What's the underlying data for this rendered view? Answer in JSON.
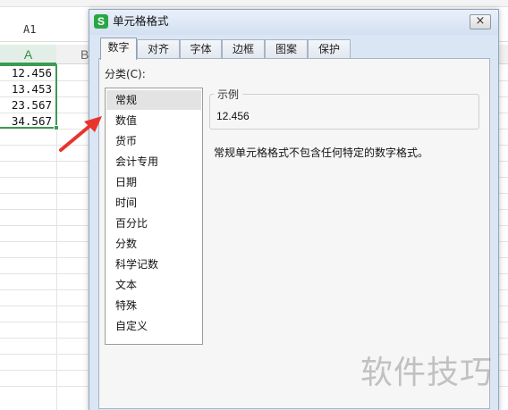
{
  "sheet": {
    "name_box": "A1",
    "column_a": "A",
    "column_b": "B",
    "cells": [
      "12.456",
      "13.453",
      "23.567",
      "34.567"
    ]
  },
  "dialog": {
    "app_icon": "S",
    "title": "单元格格式",
    "close": "×",
    "tabs": [
      "数字",
      "对齐",
      "字体",
      "边框",
      "图案",
      "保护"
    ],
    "active_tab": "数字",
    "category_label": "分类(C):",
    "categories": [
      "常规",
      "数值",
      "货币",
      "会计专用",
      "日期",
      "时间",
      "百分比",
      "分数",
      "科学记数",
      "文本",
      "特殊",
      "自定义"
    ],
    "selected_category": "常规",
    "sample_label": "示例",
    "sample_value": "12.456",
    "description": "常规单元格格式不包含任何特定的数字格式。"
  },
  "watermark": "软件技巧",
  "colors": {
    "accent_green": "#3c9a52",
    "arrow_red": "#e8342c",
    "dialog_bg": "#dbe6f4"
  }
}
